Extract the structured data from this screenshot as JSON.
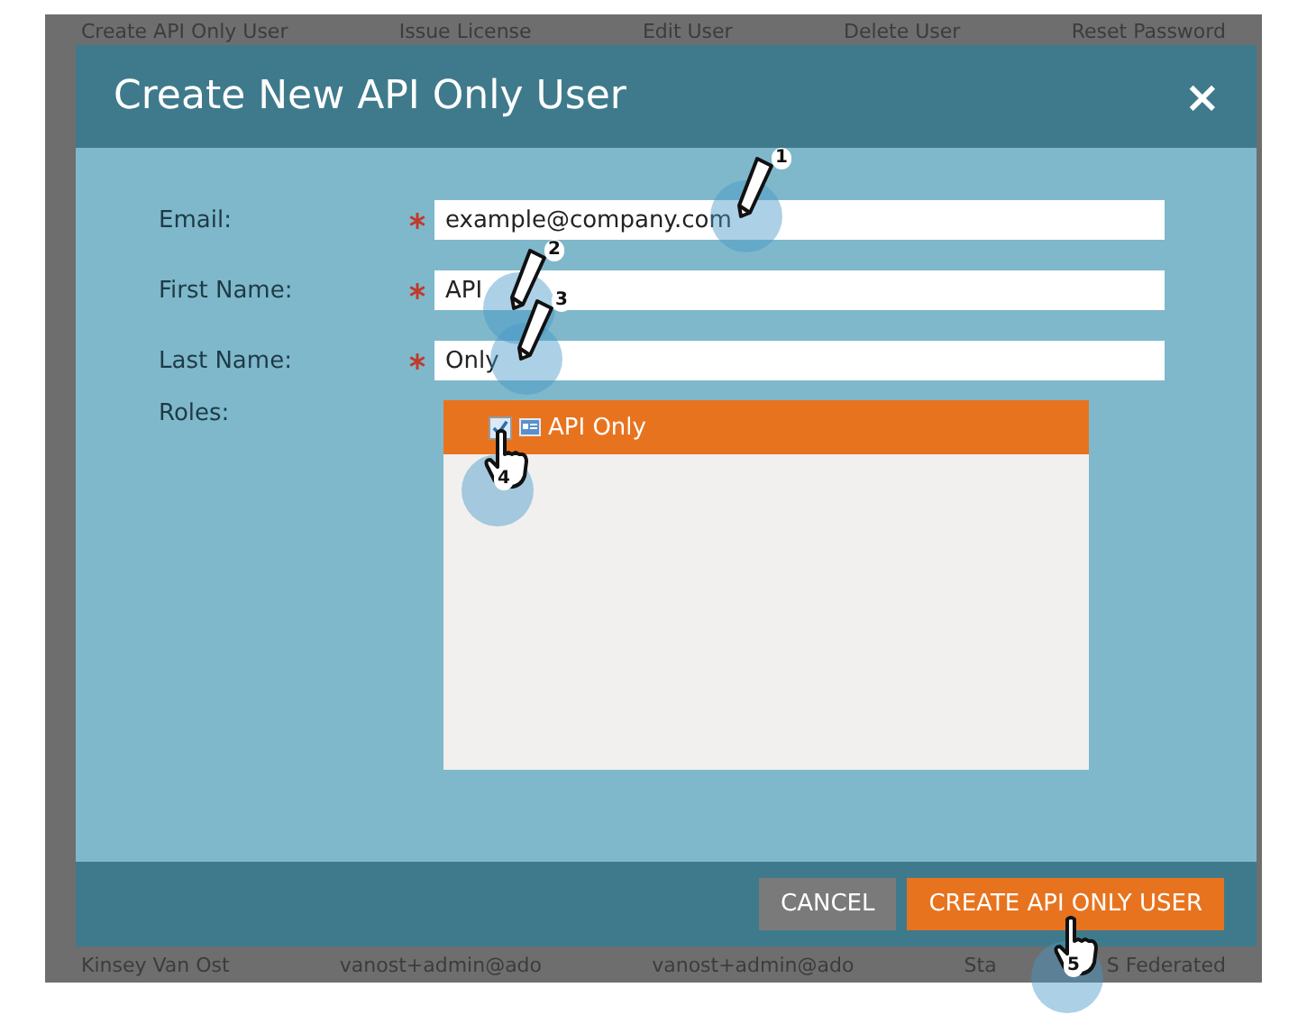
{
  "background_toolbar": [
    "Create API Only User",
    "Issue License",
    "Edit User",
    "Delete User",
    "Reset Password"
  ],
  "background_row": [
    "Kinsey Van Ost",
    "vanost+admin@ado",
    "vanost+admin@ado",
    "Sta",
    "S Federated"
  ],
  "dialog": {
    "title": "Create New API Only User",
    "close": "×",
    "fields": [
      {
        "label": "Email:",
        "required": true,
        "value": "example@company.com"
      },
      {
        "label": "First Name:",
        "required": true,
        "value": "API"
      },
      {
        "label": "Last Name:",
        "required": true,
        "value": "Only"
      }
    ],
    "roles_label": "Roles:",
    "roles": [
      {
        "name": "API Only",
        "checked": true,
        "selected": true
      }
    ],
    "buttons": [
      {
        "label": "CANCEL",
        "kind": "secondary"
      },
      {
        "label": "CREATE API ONLY USER",
        "kind": "primary"
      }
    ]
  },
  "callouts": [
    {
      "number": "1",
      "kind": "pencil"
    },
    {
      "number": "2",
      "kind": "pencil"
    },
    {
      "number": "3",
      "kind": "pencil"
    },
    {
      "number": "4",
      "kind": "hand"
    },
    {
      "number": "5",
      "kind": "hand"
    }
  ]
}
